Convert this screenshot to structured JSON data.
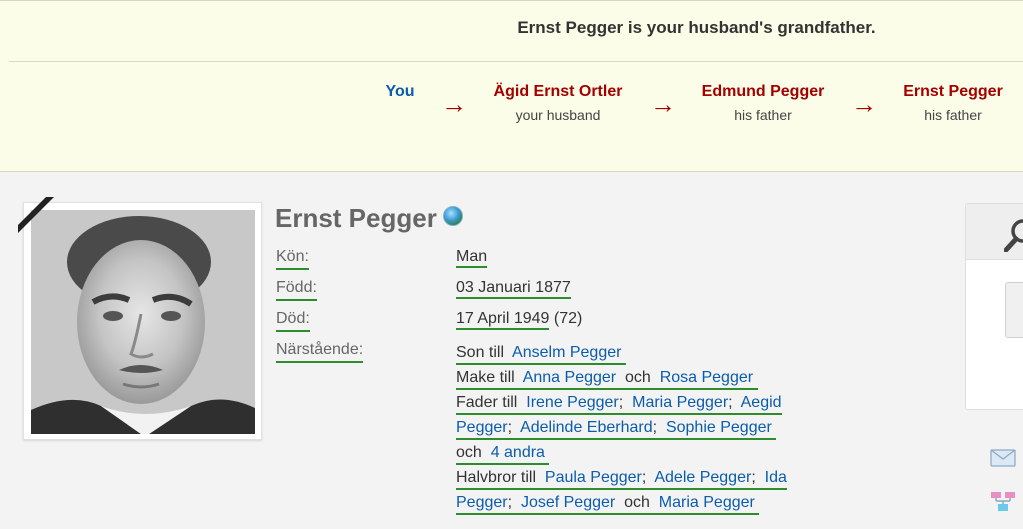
{
  "banner": {
    "title": "Ernst Pegger is your husband's grandfather.",
    "chain": [
      {
        "name": "You",
        "role": ""
      },
      {
        "name": "Ägid Ernst Ortler",
        "role": "your husband"
      },
      {
        "name": "Edmund Pegger",
        "role": "his father"
      },
      {
        "name": "Ernst Pegger",
        "role": "his father"
      }
    ],
    "arrow": "→"
  },
  "profile": {
    "name": "Ernst Pegger",
    "facts": {
      "gender_label": "Kön:",
      "gender_value": "Man",
      "born_label": "Född:",
      "born_value": "03 Januari 1877",
      "died_label": "Död:",
      "died_value": "17 April 1949",
      "died_age": "(72)",
      "relatives_label": "Närstående:"
    },
    "relatives": {
      "son_of_prefix": "Son till",
      "father_name": "Anselm Pegger",
      "husband_of_prefix": "Make till",
      "wife_1": "Anna Pegger",
      "and_word": "och",
      "wife_2": "Rosa Pegger",
      "father_of_prefix": "Fader till",
      "child_1": "Irene Pegger",
      "child_2": "Maria Pegger",
      "child_3_part1": "Aegid",
      "child_3_part2": "Pegger",
      "child_4": "Adelinde Eberhard",
      "child_5": "Sophie Pegger",
      "and_word_2": "och",
      "more_children": "4 andra",
      "half_brother_prefix": "Halvbror till",
      "sibling_1": "Paula Pegger",
      "sibling_2": "Adele Pegger",
      "sibling_3_part1": "Ida",
      "sibling_3_part2": "Pegger",
      "sibling_4": "Josef Pegger",
      "and_word_3": "och",
      "sibling_5": "Maria Pegger",
      "separator": ";"
    }
  },
  "icons": {
    "globe": "globe-icon",
    "search": "search-icon",
    "mail": "envelope-icon",
    "tree": "family-tree-icon"
  },
  "colors": {
    "accent_red": "#a40000",
    "link_blue": "#0b5cad",
    "underline_green": "#2e8b2e",
    "banner_bg": "#fcfde8"
  }
}
